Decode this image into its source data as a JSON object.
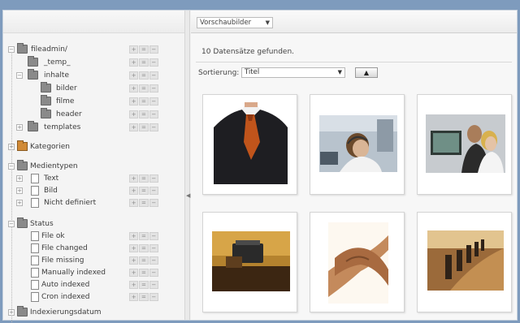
{
  "tree": {
    "items": [
      {
        "label": "fileadmin/",
        "icon": "server-folder-icon"
      },
      {
        "label": "_temp_",
        "icon": "folder-icon"
      },
      {
        "label": "inhalte",
        "icon": "folder-icon"
      },
      {
        "label": "bilder",
        "icon": "folder-icon"
      },
      {
        "label": "filme",
        "icon": "folder-icon"
      },
      {
        "label": "header",
        "icon": "folder-icon"
      },
      {
        "label": "templates",
        "icon": "folder-icon"
      },
      {
        "label": "Kategorien",
        "icon": "category-folder-icon"
      },
      {
        "label": "Medientypen",
        "icon": "folder-icon"
      },
      {
        "label": "Text",
        "icon": "text-document-icon"
      },
      {
        "label": "Bild",
        "icon": "image-document-icon"
      },
      {
        "label": "Nicht definiert",
        "icon": "document-icon"
      },
      {
        "label": "Status",
        "icon": "folder-icon"
      },
      {
        "label": "File ok",
        "icon": "file-ok-icon"
      },
      {
        "label": "File changed",
        "icon": "file-changed-icon"
      },
      {
        "label": "File missing",
        "icon": "file-missing-icon"
      },
      {
        "label": "Manually indexed",
        "icon": "file-indexed-icon"
      },
      {
        "label": "Auto indexed",
        "icon": "file-indexed-icon"
      },
      {
        "label": "Cron indexed",
        "icon": "file-indexed-icon"
      },
      {
        "label": "Indexierungsdatum",
        "icon": "calendar-folder-icon"
      }
    ],
    "control_labels": [
      "+",
      "=",
      "−"
    ]
  },
  "toolbar": {
    "view_select": "Vorschaubilder"
  },
  "results": {
    "count_text": "10 Datensätze gefunden.",
    "sort_label": "Sortierung:",
    "sort_value": "Titel",
    "sort_direction": "▲"
  },
  "thumbnails": [
    {
      "subject": "businessman-tie"
    },
    {
      "subject": "call-center-agent"
    },
    {
      "subject": "office-team"
    },
    {
      "subject": "typewriter-desk"
    },
    {
      "subject": "handshake"
    },
    {
      "subject": "conference-table"
    }
  ],
  "colors": {
    "background": "#7e9bbd",
    "panel": "#f4f4f4",
    "folder": "#8a8a8a",
    "category_folder": "#d18a36"
  }
}
